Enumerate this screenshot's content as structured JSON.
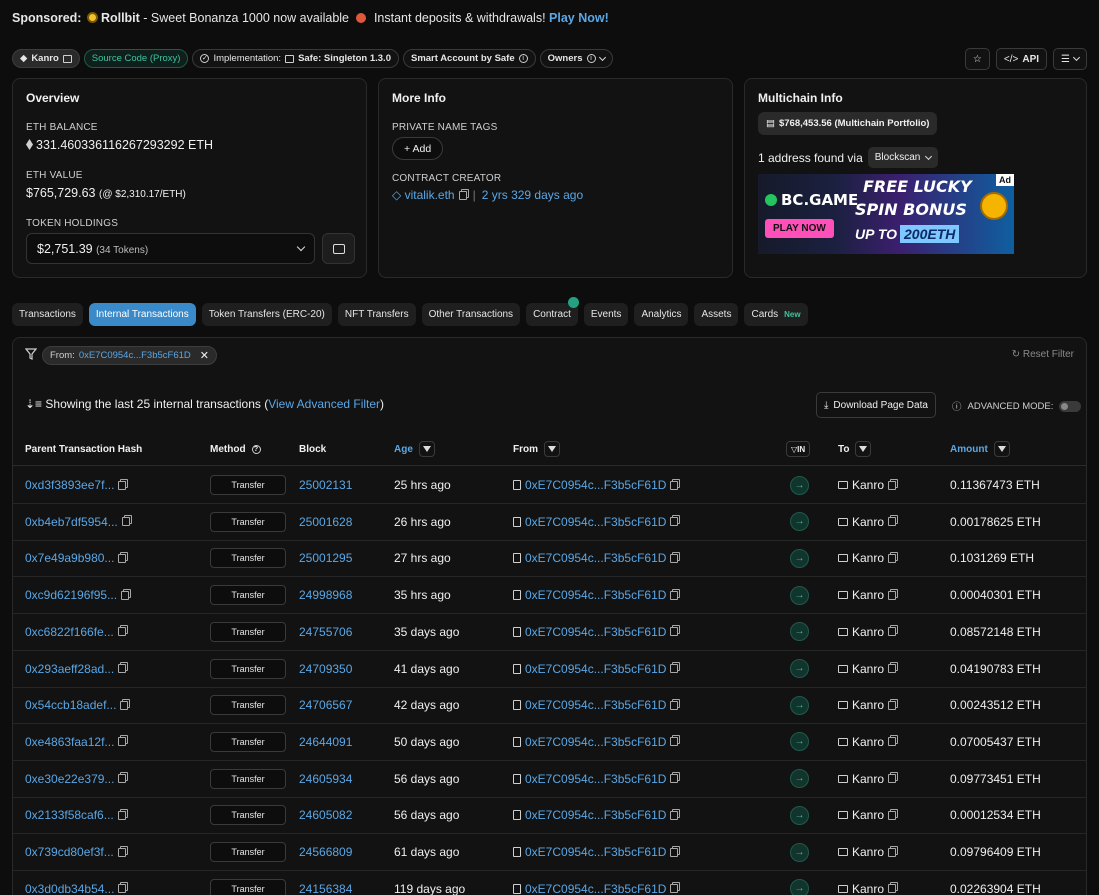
{
  "sponsor": {
    "label": "Sponsored:",
    "brand": "Rollbit",
    "text1": " - Sweet Bonanza 1000 now available ",
    "text2": " Instant deposits & withdrawals! ",
    "cta": "Play Now!"
  },
  "tags": {
    "name": "Kanro",
    "source": "Source Code (Proxy)",
    "impl_label": "Implementation:",
    "impl_value": "Safe: Singleton 1.3.0",
    "smart": "Smart Account by Safe",
    "owners": "Owners"
  },
  "top_buttons": {
    "api": "API"
  },
  "overview": {
    "title": "Overview",
    "eth_balance_label": "ETH BALANCE",
    "eth_balance": "331.460336116267293292 ETH",
    "eth_value_label": "ETH VALUE",
    "eth_value": "$765,729.63",
    "eth_rate": "(@ $2,310.17/ETH)",
    "token_label": "TOKEN HOLDINGS",
    "token_value": "$2,751.39",
    "token_count": "(34 Tokens)"
  },
  "more_info": {
    "title": "More Info",
    "tags_label": "PRIVATE NAME TAGS",
    "add_label": "+ Add",
    "creator_label": "CONTRACT CREATOR",
    "creator": "vitalik.eth",
    "created_age": "2 yrs 329 days ago"
  },
  "multichain": {
    "title": "Multichain Info",
    "portfolio": "$768,453.56 (Multichain Portfolio)",
    "found": "1 address found via",
    "scanner": "Blockscan",
    "ad": {
      "brand": "BC.GAME",
      "cta": "PLAY NOW",
      "line1": "FREE LUCKY",
      "line2": "SPIN BONUS",
      "line3": "UP TO",
      "amount": "200ETH",
      "tag": "Ad"
    }
  },
  "tabs": [
    {
      "label": "Transactions"
    },
    {
      "label": "Internal Transactions"
    },
    {
      "label": "Token Transfers (ERC-20)"
    },
    {
      "label": "NFT Transfers"
    },
    {
      "label": "Other Transactions"
    },
    {
      "label": "Contract"
    },
    {
      "label": "Events"
    },
    {
      "label": "Analytics"
    },
    {
      "label": "Assets"
    },
    {
      "label": "Cards",
      "badge": "New"
    }
  ],
  "panel": {
    "filter_label": "From:",
    "filter_value": "0xE7C0954c...F3b5cF61D",
    "reset": "Reset Filter",
    "showing": "Showing the last 25 internal transactions (",
    "adv_filter": "View Advanced Filter",
    "showing_end": ")",
    "download": "Download Page Data",
    "adv_mode": "ADVANCED MODE:"
  },
  "columns": {
    "hash": "Parent Transaction Hash",
    "method": "Method",
    "block": "Block",
    "age": "Age",
    "from": "From",
    "in": "IN",
    "to": "To",
    "amount": "Amount"
  },
  "rows": [
    {
      "hash": "0xd3f3893ee7f...",
      "method": "Transfer",
      "block": "25002131",
      "age": "25 hrs ago",
      "from": "0xE7C0954c...F3b5cF61D",
      "to": "Kanro",
      "amount": "0.11367473 ETH"
    },
    {
      "hash": "0xb4eb7df5954...",
      "method": "Transfer",
      "block": "25001628",
      "age": "26 hrs ago",
      "from": "0xE7C0954c...F3b5cF61D",
      "to": "Kanro",
      "amount": "0.00178625 ETH"
    },
    {
      "hash": "0x7e49a9b980...",
      "method": "Transfer",
      "block": "25001295",
      "age": "27 hrs ago",
      "from": "0xE7C0954c...F3b5cF61D",
      "to": "Kanro",
      "amount": "0.1031269 ETH"
    },
    {
      "hash": "0xc9d62196f95...",
      "method": "Transfer",
      "block": "24998968",
      "age": "35 hrs ago",
      "from": "0xE7C0954c...F3b5cF61D",
      "to": "Kanro",
      "amount": "0.00040301 ETH"
    },
    {
      "hash": "0xc6822f166fe...",
      "method": "Transfer",
      "block": "24755706",
      "age": "35 days ago",
      "from": "0xE7C0954c...F3b5cF61D",
      "to": "Kanro",
      "amount": "0.08572148 ETH"
    },
    {
      "hash": "0x293aeff28ad...",
      "method": "Transfer",
      "block": "24709350",
      "age": "41 days ago",
      "from": "0xE7C0954c...F3b5cF61D",
      "to": "Kanro",
      "amount": "0.04190783 ETH"
    },
    {
      "hash": "0x54ccb18adef...",
      "method": "Transfer",
      "block": "24706567",
      "age": "42 days ago",
      "from": "0xE7C0954c...F3b5cF61D",
      "to": "Kanro",
      "amount": "0.00243512 ETH"
    },
    {
      "hash": "0xe4863faa12f...",
      "method": "Transfer",
      "block": "24644091",
      "age": "50 days ago",
      "from": "0xE7C0954c...F3b5cF61D",
      "to": "Kanro",
      "amount": "0.07005437 ETH"
    },
    {
      "hash": "0xe30e22e379...",
      "method": "Transfer",
      "block": "24605934",
      "age": "56 days ago",
      "from": "0xE7C0954c...F3b5cF61D",
      "to": "Kanro",
      "amount": "0.09773451 ETH"
    },
    {
      "hash": "0x2133f58caf6...",
      "method": "Transfer",
      "block": "24605082",
      "age": "56 days ago",
      "from": "0xE7C0954c...F3b5cF61D",
      "to": "Kanro",
      "amount": "0.00012534 ETH"
    },
    {
      "hash": "0x739cd80ef3f...",
      "method": "Transfer",
      "block": "24566809",
      "age": "61 days ago",
      "from": "0xE7C0954c...F3b5cF61D",
      "to": "Kanro",
      "amount": "0.09796409 ETH"
    },
    {
      "hash": "0x3d0db34b54...",
      "method": "Transfer",
      "block": "24156384",
      "age": "119 days ago",
      "from": "0xE7C0954c...F3b5cF61D",
      "to": "Kanro",
      "amount": "0.02263904 ETH"
    }
  ]
}
